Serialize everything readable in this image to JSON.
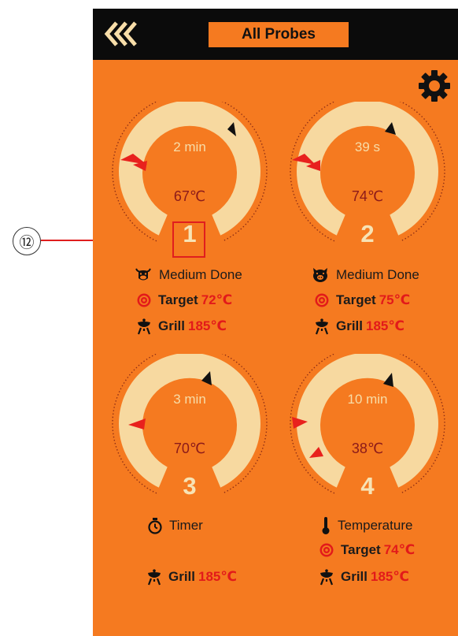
{
  "header": {
    "title": "All Probes"
  },
  "annotation": {
    "label": "⑫"
  },
  "colors": {
    "background": "#F57A20",
    "gauge_track": "#F7D9A0",
    "header": "#0B0B0B",
    "accent_red": "#E21A1A"
  },
  "probes": [
    {
      "number": "1",
      "timer": "2 min",
      "temp": "67℃",
      "meat": {
        "icon": "cow-icon",
        "label": "Medium Done"
      },
      "target": {
        "label": "Target",
        "value": "72℃"
      },
      "grill": {
        "label": "Grill",
        "value": "185℃"
      }
    },
    {
      "number": "2",
      "timer": "39 s",
      "temp": "74℃",
      "meat": {
        "icon": "pig-icon",
        "label": "Medium Done"
      },
      "target": {
        "label": "Target",
        "value": "75℃"
      },
      "grill": {
        "label": "Grill",
        "value": "185℃"
      }
    },
    {
      "number": "3",
      "timer": "3 min",
      "temp": "70℃",
      "mode": {
        "icon": "stopwatch-icon",
        "label": "Timer"
      },
      "grill": {
        "label": "Grill",
        "value": "185℃"
      }
    },
    {
      "number": "4",
      "timer": "10 min",
      "temp": "38℃",
      "mode": {
        "icon": "thermometer-icon",
        "label": "Temperature"
      },
      "target": {
        "label": "Target",
        "value": "74℃"
      },
      "grill": {
        "label": "Grill",
        "value": "185℃"
      }
    }
  ]
}
